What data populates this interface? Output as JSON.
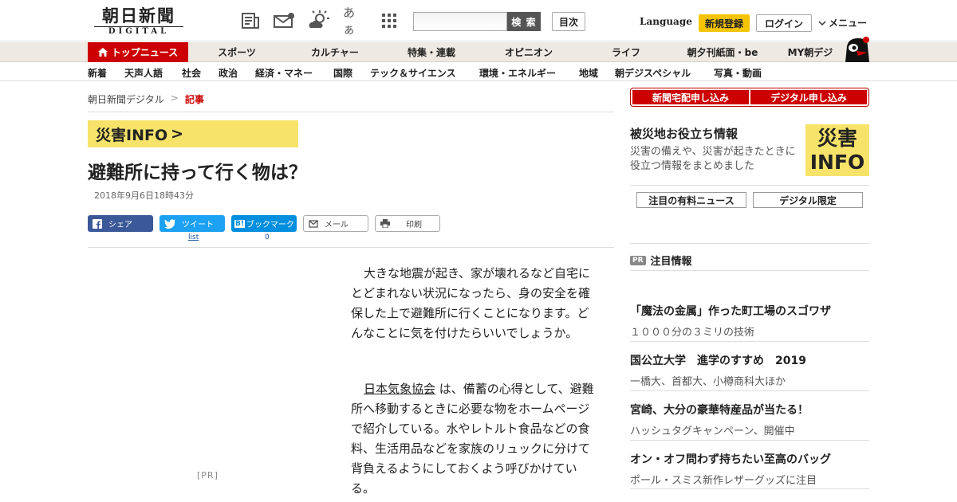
{
  "header": {
    "logo_jp": "朝日新聞",
    "logo_en": "DIGITAL",
    "icons": [
      "newspaper-icon",
      "mail-icon",
      "weather-icon",
      "font-size-icon",
      "grid-icon"
    ],
    "font_icon_text": "あぁ",
    "search_button": "検 索",
    "toc_button": "目次",
    "language": "Language",
    "signup": "新規登録",
    "login": "ログイン",
    "menu": "メニュー"
  },
  "nav_main": [
    {
      "label": "トップニュース",
      "active": true
    },
    {
      "label": "スポーツ"
    },
    {
      "label": "カルチャー"
    },
    {
      "label": "特集・連載"
    },
    {
      "label": "オピニオン"
    },
    {
      "label": "ライフ"
    },
    {
      "label": "朝夕刊紙面・be"
    },
    {
      "label": "MY朝デジ"
    }
  ],
  "nav_sub": [
    "新着",
    "天声人語",
    "社会",
    "政治",
    "経済・マネー",
    "国際",
    "テック＆サイエンス",
    "環境・エネルギー",
    "地域",
    "朝デジスペシャル",
    "写真・動画"
  ],
  "breadcrumb": {
    "home": "朝日新聞デジタル",
    "sep": ">",
    "current": "記事"
  },
  "banner": {
    "text": "災害INFO",
    "arrow": ">"
  },
  "article": {
    "title": "避難所に持って行く物は？",
    "date": "2018年9月6日18時43分",
    "share": {
      "facebook": "シェア",
      "twitter": "ツイート",
      "hatena": "ブックマーク",
      "hatena_prefix": "B!",
      "mail": "メール",
      "print": "印刷",
      "twitter_count": "list",
      "hatena_count": "0"
    },
    "pr_label": "[PR]",
    "para1": "大きな地震が起き、家が壊れるなど自宅にとどまれない状況になったら、身の安全を確保した上で避難所に行くことになります。どんなことに気を付けたらいいでしょうか。",
    "para2_link": "日本気象協会",
    "para2_rest": " は、備蓄の心得として、避難所へ移動するときに必要な物をホームページで紹介している。水やレトルト食品などの食料、生活用品などを家族のリュックに分けて背負えるようにしておくよう呼びかけている。"
  },
  "sidebar": {
    "red_buttons": [
      "新聞宅配申し込み",
      "デジタル申し込み"
    ],
    "aid_title": "被災地お役立ち情報",
    "aid_desc": "災害の備えや、災害が起きたときに役立つ情報をまとめました",
    "aid_logo_top": "災害",
    "aid_logo_bottom": "INFO",
    "white_buttons": [
      "注目の有料ニュース",
      "デジタル限定"
    ],
    "pr_tag": "PR",
    "pr_heading": "注目情報",
    "ads": [
      {
        "title": "「魔法の金属」作った町工場のスゴワザ",
        "sub": "１０００分の３ミリの技術"
      },
      {
        "title": "国公立大学　進学のすすめ　2019",
        "sub": "一橋大、首都大、小樽商科大ほか"
      },
      {
        "title": "宮崎、大分の豪華特産品が当たる！",
        "sub": "ハッシュタグキャンペーン、開催中"
      },
      {
        "title": "オン・オフ問わず持ちたい至高のバッグ",
        "sub": "ポール・スミス新作レザーグッズに注目"
      }
    ]
  },
  "colors": {
    "brand_red": "#cc0000",
    "info_yellow": "#f7e36a",
    "signup_yellow": "#f5c400"
  }
}
